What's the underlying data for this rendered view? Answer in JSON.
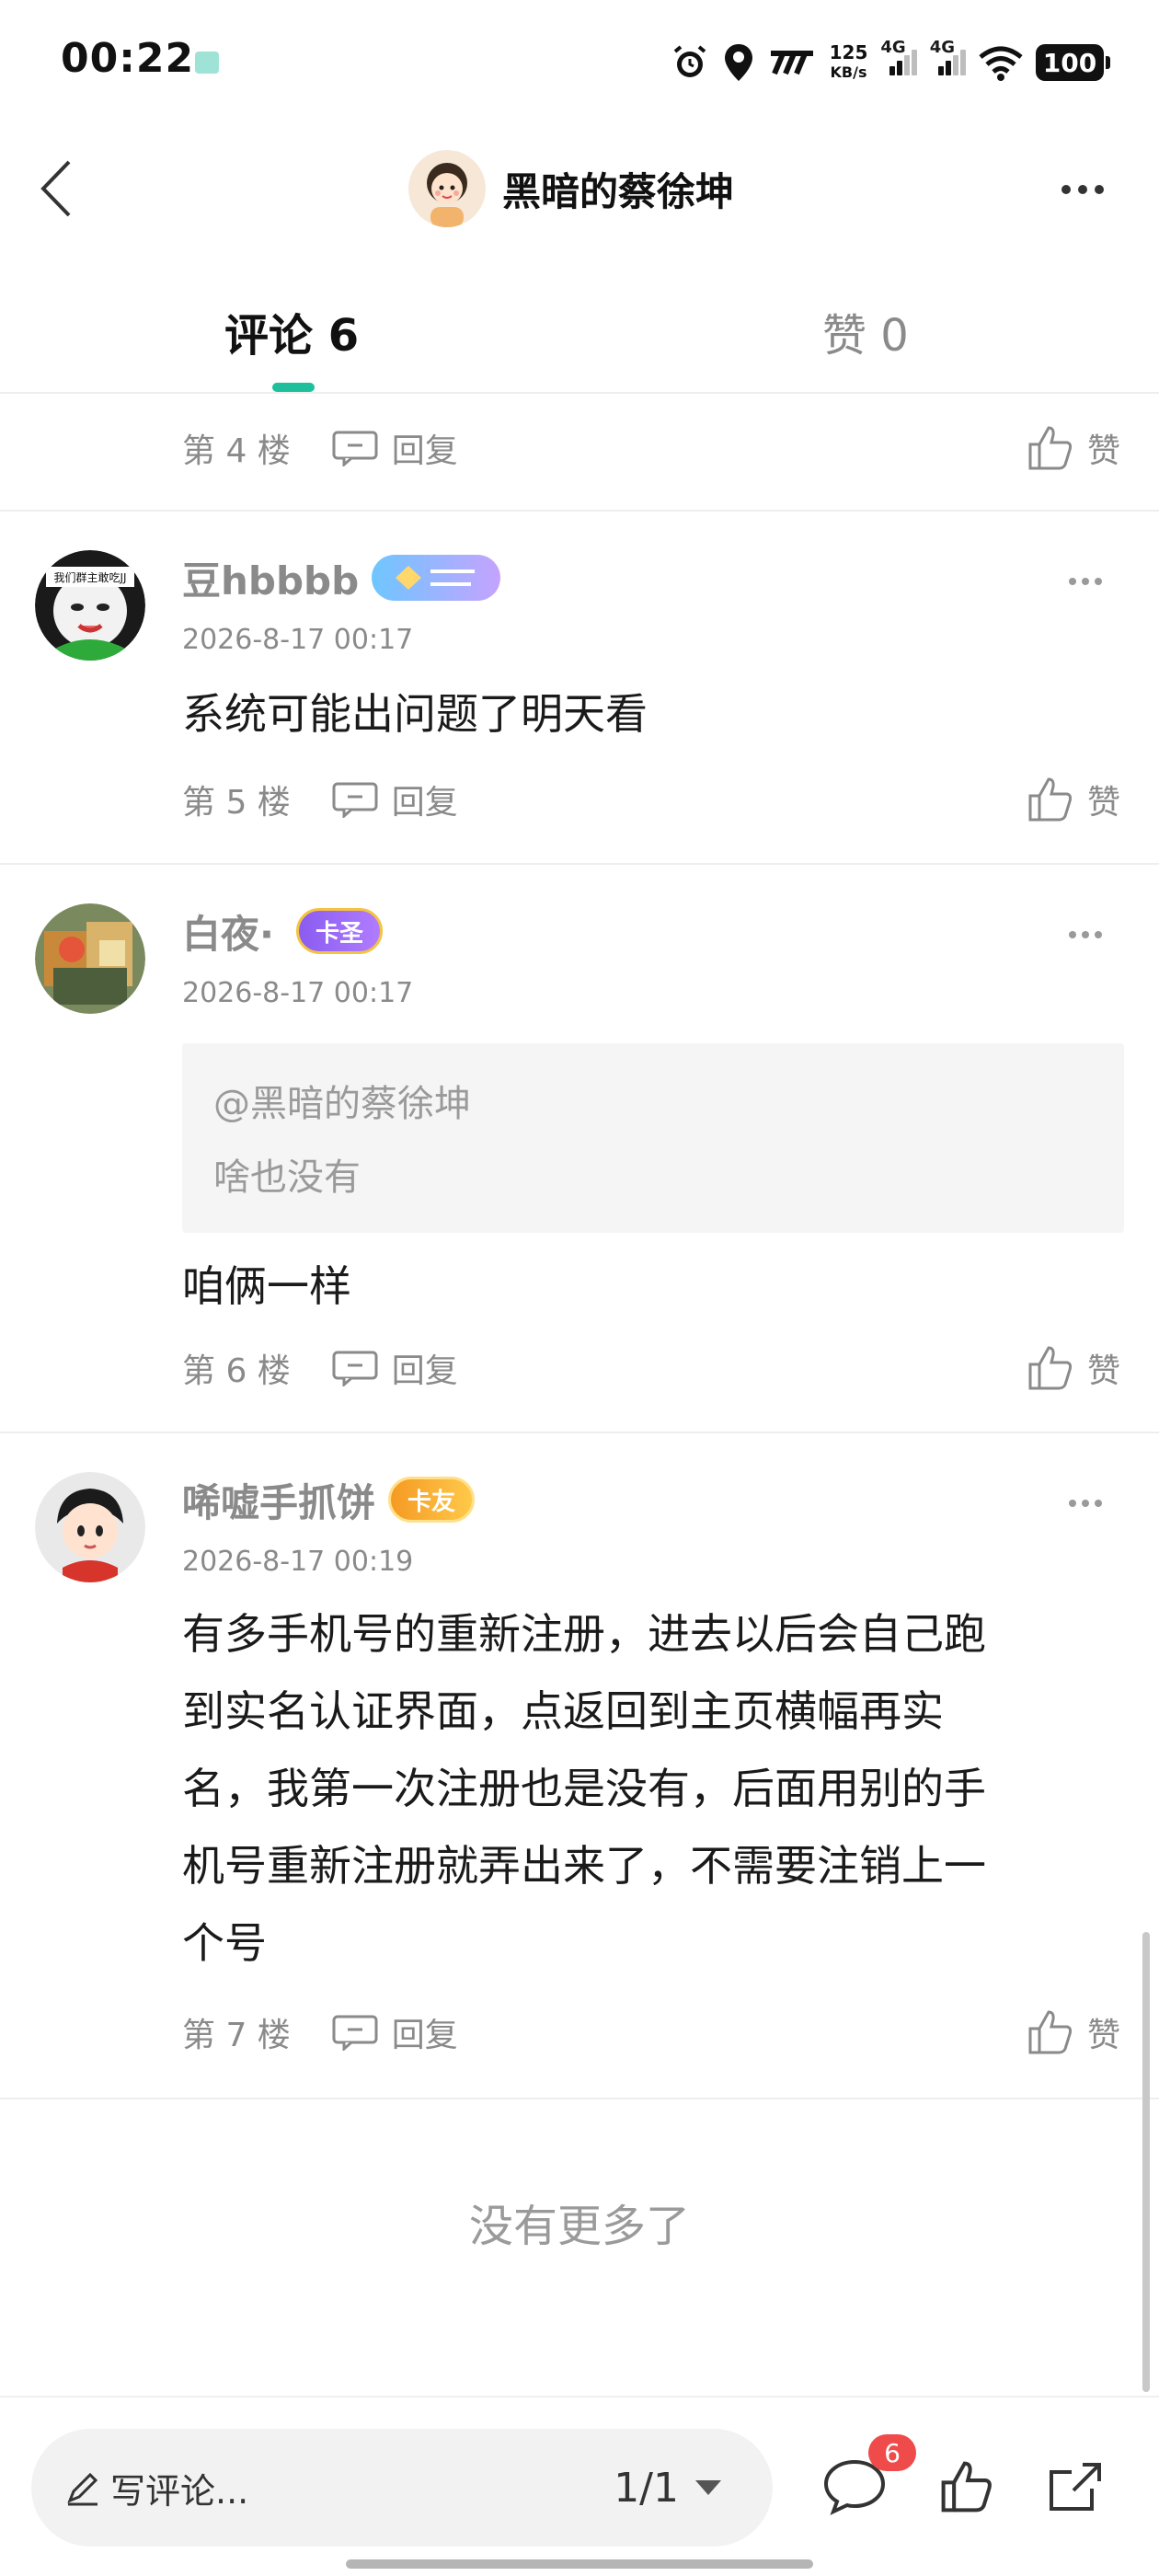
{
  "status_bar": {
    "time": "00:22",
    "net_speed_value": "125",
    "net_speed_unit": "KB/s",
    "signal_1_label": "4G",
    "signal_2_label": "4G",
    "battery": "100"
  },
  "header": {
    "title": "黑暗的蔡徐坤"
  },
  "tabs": [
    {
      "label": "评论 6",
      "active": true
    },
    {
      "label": "赞 0",
      "active": false
    }
  ],
  "comments": [
    {
      "floor": "第 4 楼",
      "reply_label": "回复",
      "like_label": "赞"
    },
    {
      "username": "豆hbbbb",
      "timestamp": "2026-8-17 00:17",
      "text": "系统可能出问题了明天看",
      "floor": "第 5 楼",
      "reply_label": "回复",
      "like_label": "赞",
      "avatar_text": "我们群主敢吃JJ"
    },
    {
      "username": "白夜·",
      "badge": "卡圣",
      "timestamp": "2026-8-17 00:17",
      "quote_user": "@黑暗的蔡徐坤",
      "quote_text": "啥也没有",
      "text": "咱俩一样",
      "floor": "第 6 楼",
      "reply_label": "回复",
      "like_label": "赞"
    },
    {
      "username": "唏嘘手抓饼",
      "badge": "卡友",
      "timestamp": "2026-8-17 00:19",
      "text_lines": [
        "有多手机号的重新注册，进去以后会自己跑",
        "到实名认证界面，点返回到主页横幅再实",
        "名，我第一次注册也是没有，后面用别的手",
        "机号重新注册就弄出来了，不需要注销上一",
        "个号"
      ],
      "floor": "第 7 楼",
      "reply_label": "回复",
      "like_label": "赞"
    }
  ],
  "end_text": "没有更多了",
  "bottom_bar": {
    "compose_label": "写评论...",
    "pager": "1/1",
    "comment_count": "6"
  },
  "colors": {
    "accent": "#1fbf9c",
    "badge_red": "#f04b4b",
    "muted_text": "#8a8a8a"
  }
}
